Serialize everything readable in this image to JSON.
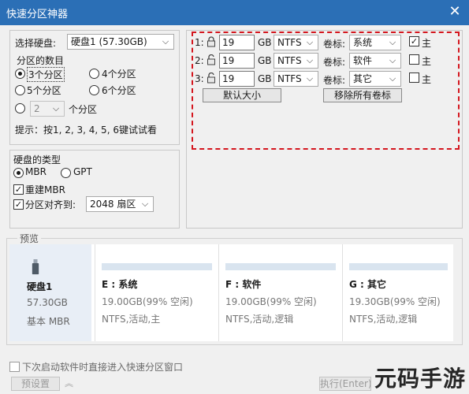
{
  "window": {
    "title": "快速分区神器"
  },
  "disk_select": {
    "label": "选择硬盘:",
    "value": "硬盘1 (57.30GB)"
  },
  "partition_count": {
    "label": "分区的数目",
    "opt3": "3个分区",
    "opt4": "4个分区",
    "opt5": "5个分区",
    "opt6": "6个分区",
    "custom_value": "2",
    "custom_suffix": "个分区",
    "selected": "3"
  },
  "hint": "提示：按1, 2, 3, 4, 5, 6键试试看",
  "disk_type": {
    "label": "硬盘的类型",
    "mbr": "MBR",
    "gpt": "GPT",
    "rebuild_mbr": "重建MBR",
    "align_label": "分区对齐到:",
    "align_value": "2048 扇区"
  },
  "partitions": [
    {
      "index": "1:",
      "size": "19",
      "unit": "GB",
      "fs": "NTFS",
      "vol_label_text": "卷标:",
      "vol_label": "系统",
      "primary_label": "主",
      "primary_checked": true
    },
    {
      "index": "2:",
      "size": "19",
      "unit": "GB",
      "fs": "NTFS",
      "vol_label_text": "卷标:",
      "vol_label": "软件",
      "primary_label": "主",
      "primary_checked": false
    },
    {
      "index": "3:",
      "size": "19",
      "unit": "GB",
      "fs": "NTFS",
      "vol_label_text": "卷标:",
      "vol_label": "其它",
      "primary_label": "主",
      "primary_checked": false
    }
  ],
  "buttons": {
    "default_size": "默认大小",
    "remove_labels": "移除所有卷标"
  },
  "preview": {
    "label": "预览",
    "disk": {
      "name": "硬盘1",
      "size": "57.30GB",
      "type": "基本 MBR"
    },
    "parts": [
      {
        "name": "E : 系统",
        "size": "19.00GB(99% 空闲)",
        "info": "NTFS,活动,主"
      },
      {
        "name": "F : 软件",
        "size": "19.00GB(99% 空闲)",
        "info": "NTFS,活动,逻辑"
      },
      {
        "name": "G : 其它",
        "size": "19.30GB(99% 空闲)",
        "info": "NTFS,活动,逻辑"
      }
    ]
  },
  "footer": {
    "startup_text": "下次启动软件时直接进入快速分区窗口",
    "preset_button": "预设置",
    "execute_button": "执行(Enter)"
  },
  "watermark": "元码手游网"
}
